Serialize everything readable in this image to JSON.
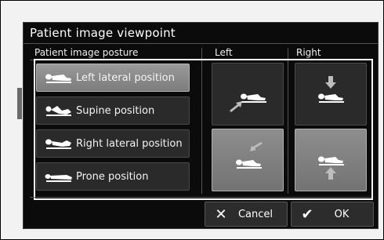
{
  "dialog": {
    "title": "Patient image viewpoint",
    "posture_header": "Patient image posture",
    "left_header": "Left",
    "right_header": "Right",
    "postures": [
      {
        "label": "Left lateral position",
        "icon": "left-lateral-patient-icon",
        "selected": true
      },
      {
        "label": "Supine position",
        "icon": "supine-patient-icon",
        "selected": false
      },
      {
        "label": "Right lateral position",
        "icon": "right-lateral-patient-icon",
        "selected": false
      },
      {
        "label": "Prone position",
        "icon": "prone-patient-icon",
        "selected": false
      }
    ],
    "views": [
      {
        "column": "Left",
        "row": 1,
        "arrow": "from-lower-left",
        "selected": false
      },
      {
        "column": "Right",
        "row": 1,
        "arrow": "from-top",
        "selected": false
      },
      {
        "column": "Left",
        "row": 2,
        "arrow": "from-upper-right",
        "selected": true
      },
      {
        "column": "Right",
        "row": 2,
        "arrow": "from-bottom",
        "selected": true
      }
    ],
    "cancel_label": "Cancel",
    "ok_label": "OK",
    "colors": {
      "selected": "#8a8a8a",
      "button": "#2a2a2a",
      "background": "#0b0b0b"
    }
  }
}
